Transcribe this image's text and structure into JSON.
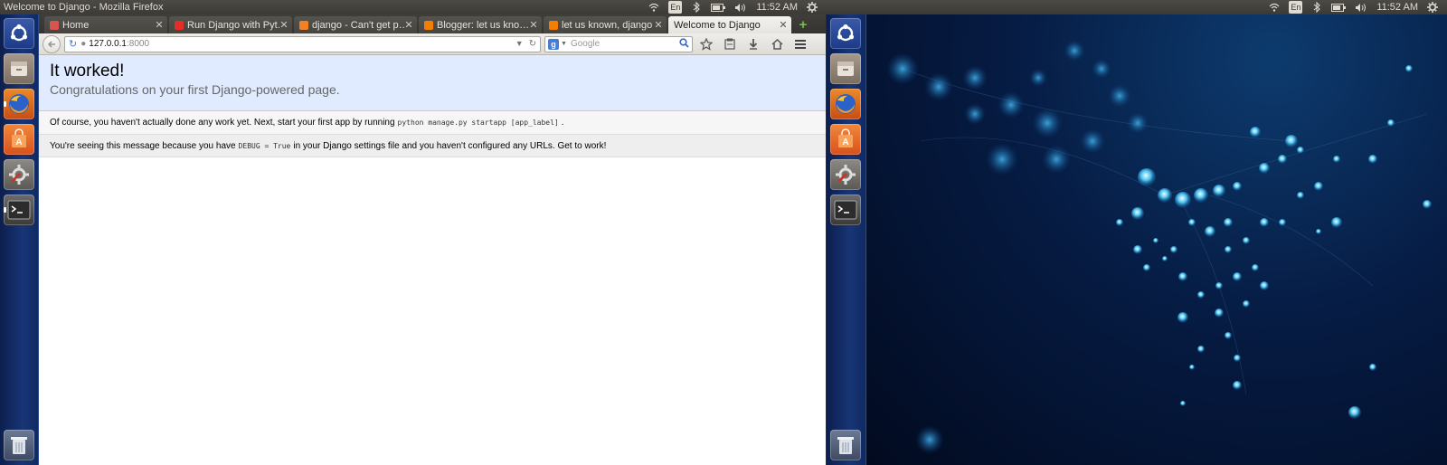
{
  "panel": {
    "window_title": "Welcome to Django - Mozilla Firefox",
    "lang": "En",
    "clock": "11:52 AM"
  },
  "launcher": {
    "items": [
      "dash-home",
      "files",
      "firefox",
      "software-center",
      "system-settings",
      "terminal",
      "trash"
    ]
  },
  "browser": {
    "tabs": [
      {
        "label": "Home",
        "favicon_color": "#d9534f"
      },
      {
        "label": "Run Django with Pyt…",
        "favicon_color": "#e52d27"
      },
      {
        "label": "django - Can't get p…",
        "favicon_color": "#f48024"
      },
      {
        "label": "Blogger: let us kno…",
        "favicon_color": "#f57d00"
      },
      {
        "label": "let us known, django",
        "favicon_color": "#f57d00"
      },
      {
        "label": "Welcome to Django",
        "favicon_color": "#888888"
      }
    ],
    "url_host": "127.0.0.1",
    "url_port": ":8000",
    "search_placeholder": "Google"
  },
  "page": {
    "heading": "It worked!",
    "subheading": "Congratulations on your first Django-powered page.",
    "instructions_before": "Of course, you haven't actually done any work yet. Next, start your first app by running",
    "instructions_code": "python manage.py startapp [app_label]",
    "instructions_after": ".",
    "explanation_before": "You're seeing this message because you have",
    "explanation_code": "DEBUG = True",
    "explanation_after": "in your Django settings file and you haven't configured any URLs. Get to work!"
  }
}
